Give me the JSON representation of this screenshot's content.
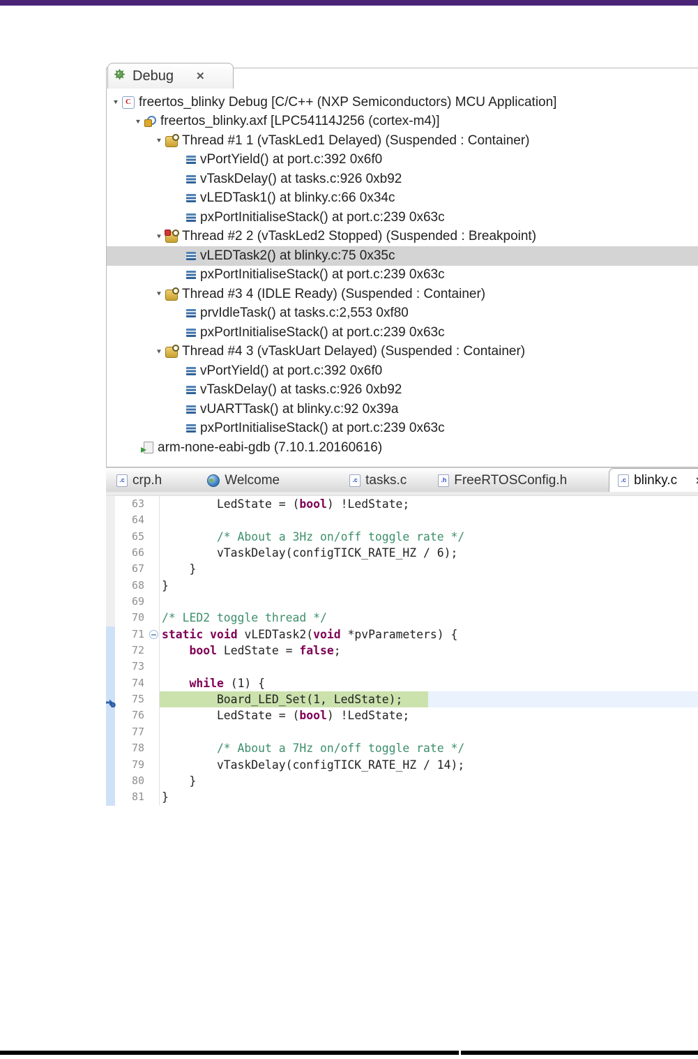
{
  "window": {
    "top_bar_color": "#4b2478",
    "bottom_bar_color": "#000000"
  },
  "glyphs": {
    "expander": "▼",
    "close": "✕",
    "c_app_letter": "C",
    "c_file_label": ".c",
    "h_file_label": ".h"
  },
  "debug_panel": {
    "tab_label": "Debug",
    "tree": [
      {
        "level": 0,
        "expanded": true,
        "icon": "c-app",
        "text": "freertos_blinky Debug [C/C++ (NXP Semiconductors) MCU Application]"
      },
      {
        "level": 1,
        "expanded": true,
        "icon": "axf",
        "text": "freertos_blinky.axf [LPC54114J256 (cortex-m4)]"
      },
      {
        "level": 2,
        "expanded": true,
        "icon": "thread",
        "text": "Thread #1 1 (vTaskLed1 Delayed) (Suspended : Container)"
      },
      {
        "level": 3,
        "icon": "stack",
        "text": "vPortYield() at port.c:392 0x6f0"
      },
      {
        "level": 3,
        "icon": "stack",
        "text": "vTaskDelay() at tasks.c:926 0xb92"
      },
      {
        "level": 3,
        "icon": "stack",
        "text": "vLEDTask1() at blinky.c:66 0x34c"
      },
      {
        "level": 3,
        "icon": "stack",
        "text": "pxPortInitialiseStack() at port.c:239 0x63c"
      },
      {
        "level": 2,
        "expanded": true,
        "icon": "thread-bp",
        "text": "Thread #2 2 (vTaskLed2 Stopped) (Suspended : Breakpoint)"
      },
      {
        "level": 3,
        "icon": "stack",
        "text": "vLEDTask2() at blinky.c:75 0x35c",
        "selected": true
      },
      {
        "level": 3,
        "icon": "stack",
        "text": "pxPortInitialiseStack() at port.c:239 0x63c"
      },
      {
        "level": 2,
        "expanded": true,
        "icon": "thread",
        "text": "Thread #3 4 (IDLE Ready) (Suspended : Container)"
      },
      {
        "level": 3,
        "icon": "stack",
        "text": "prvIdleTask() at tasks.c:2,553 0xf80"
      },
      {
        "level": 3,
        "icon": "stack",
        "text": "pxPortInitialiseStack() at port.c:239 0x63c"
      },
      {
        "level": 2,
        "expanded": true,
        "icon": "thread",
        "text": "Thread #4 3 (vTaskUart Delayed) (Suspended : Container)"
      },
      {
        "level": 3,
        "icon": "stack",
        "text": "vPortYield() at port.c:392 0x6f0"
      },
      {
        "level": 3,
        "icon": "stack",
        "text": "vTaskDelay() at tasks.c:926 0xb92"
      },
      {
        "level": 3,
        "icon": "stack",
        "text": "vUARTTask() at blinky.c:92 0x39a"
      },
      {
        "level": 3,
        "icon": "stack",
        "text": "pxPortInitialiseStack() at port.c:239 0x63c"
      },
      {
        "level": 1,
        "icon": "gdb",
        "gdb_row": true,
        "text": "arm-none-eabi-gdb (7.10.1.20160616)"
      }
    ]
  },
  "editor": {
    "tabs": [
      {
        "label": "crp.h",
        "icon": "c-file"
      },
      {
        "label": "Welcome",
        "icon": "globe"
      },
      {
        "label": "tasks.c",
        "icon": "c-file"
      },
      {
        "label": "FreeRTOSConfig.h",
        "icon": "h-file"
      },
      {
        "label": "blinky.c",
        "icon": "c-file",
        "active": true,
        "closable": true
      },
      {
        "label": "",
        "icon": "h-file",
        "partial": true
      }
    ],
    "code": {
      "syntax_colors": {
        "keyword": "#7f0055",
        "comment": "#3d8f6a",
        "plain": "#222222",
        "current_line_green": "#cbe2ad",
        "current_line_blue": "#e9f2fd"
      },
      "current_line": 75,
      "fold_line": 71,
      "range_start": 71,
      "range_end": 81,
      "lines": [
        {
          "n": 63,
          "seg": [
            [
              "pl",
              "        LedState = ("
            ],
            [
              "kw",
              "bool"
            ],
            [
              "pl",
              ") !LedState;"
            ]
          ]
        },
        {
          "n": 64,
          "seg": []
        },
        {
          "n": 65,
          "seg": [
            [
              "cm",
              "        /* About a 3Hz on/off toggle rate */"
            ]
          ]
        },
        {
          "n": 66,
          "seg": [
            [
              "pl",
              "        vTaskDelay(configTICK_RATE_HZ / 6);"
            ]
          ]
        },
        {
          "n": 67,
          "seg": [
            [
              "pl",
              "    }"
            ]
          ]
        },
        {
          "n": 68,
          "seg": [
            [
              "pl",
              "}"
            ]
          ]
        },
        {
          "n": 69,
          "seg": []
        },
        {
          "n": 70,
          "seg": [
            [
              "cm",
              "/* LED2 toggle thread */"
            ]
          ]
        },
        {
          "n": 71,
          "seg": [
            [
              "kw",
              "static"
            ],
            [
              "pl",
              " "
            ],
            [
              "kw",
              "void"
            ],
            [
              "pl",
              " vLEDTask2("
            ],
            [
              "kw",
              "void"
            ],
            [
              "pl",
              " *pvParameters) {"
            ]
          ]
        },
        {
          "n": 72,
          "seg": [
            [
              "pl",
              "    "
            ],
            [
              "kw",
              "bool"
            ],
            [
              "pl",
              " LedState = "
            ],
            [
              "kw",
              "false"
            ],
            [
              "pl",
              ";"
            ]
          ]
        },
        {
          "n": 73,
          "seg": []
        },
        {
          "n": 74,
          "seg": [
            [
              "pl",
              "    "
            ],
            [
              "kw",
              "while"
            ],
            [
              "pl",
              " (1) {"
            ]
          ]
        },
        {
          "n": 75,
          "seg": [
            [
              "pl",
              "        Board_LED_Set(1, LedState);"
            ]
          ]
        },
        {
          "n": 76,
          "seg": [
            [
              "pl",
              "        LedState = ("
            ],
            [
              "kw",
              "bool"
            ],
            [
              "pl",
              ") !LedState;"
            ]
          ]
        },
        {
          "n": 77,
          "seg": []
        },
        {
          "n": 78,
          "seg": [
            [
              "cm",
              "        /* About a 7Hz on/off toggle rate */"
            ]
          ]
        },
        {
          "n": 79,
          "seg": [
            [
              "pl",
              "        vTaskDelay(configTICK_RATE_HZ / 14);"
            ]
          ]
        },
        {
          "n": 80,
          "seg": [
            [
              "pl",
              "    }"
            ]
          ]
        },
        {
          "n": 81,
          "seg": [
            [
              "pl",
              "}"
            ]
          ]
        }
      ]
    }
  }
}
